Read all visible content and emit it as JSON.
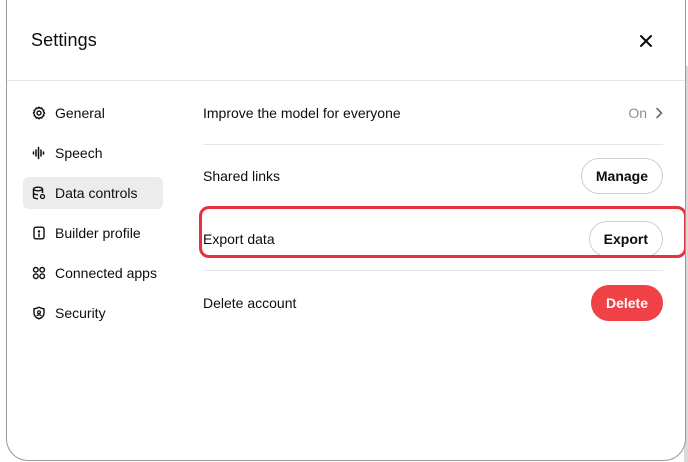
{
  "dialog": {
    "title": "Settings",
    "close_icon": "close-icon"
  },
  "sidebar": {
    "items": [
      {
        "label": "General",
        "icon": "gear-icon",
        "active": false
      },
      {
        "label": "Speech",
        "icon": "waveform-icon",
        "active": false
      },
      {
        "label": "Data controls",
        "icon": "database-icon",
        "active": true
      },
      {
        "label": "Builder profile",
        "icon": "id-badge-icon",
        "active": false
      },
      {
        "label": "Connected apps",
        "icon": "apps-grid-icon",
        "active": false
      },
      {
        "label": "Security",
        "icon": "shield-icon",
        "active": false
      }
    ]
  },
  "settings": {
    "improve_model": {
      "label": "Improve the model for everyone",
      "value": "On"
    },
    "shared_links": {
      "label": "Shared links",
      "button": "Manage"
    },
    "export_data": {
      "label": "Export data",
      "button": "Export"
    },
    "delete_account": {
      "label": "Delete account",
      "button": "Delete"
    }
  },
  "colors": {
    "highlight": "#e5333d",
    "danger": "#ef4146",
    "active_nav": "#ececec"
  }
}
